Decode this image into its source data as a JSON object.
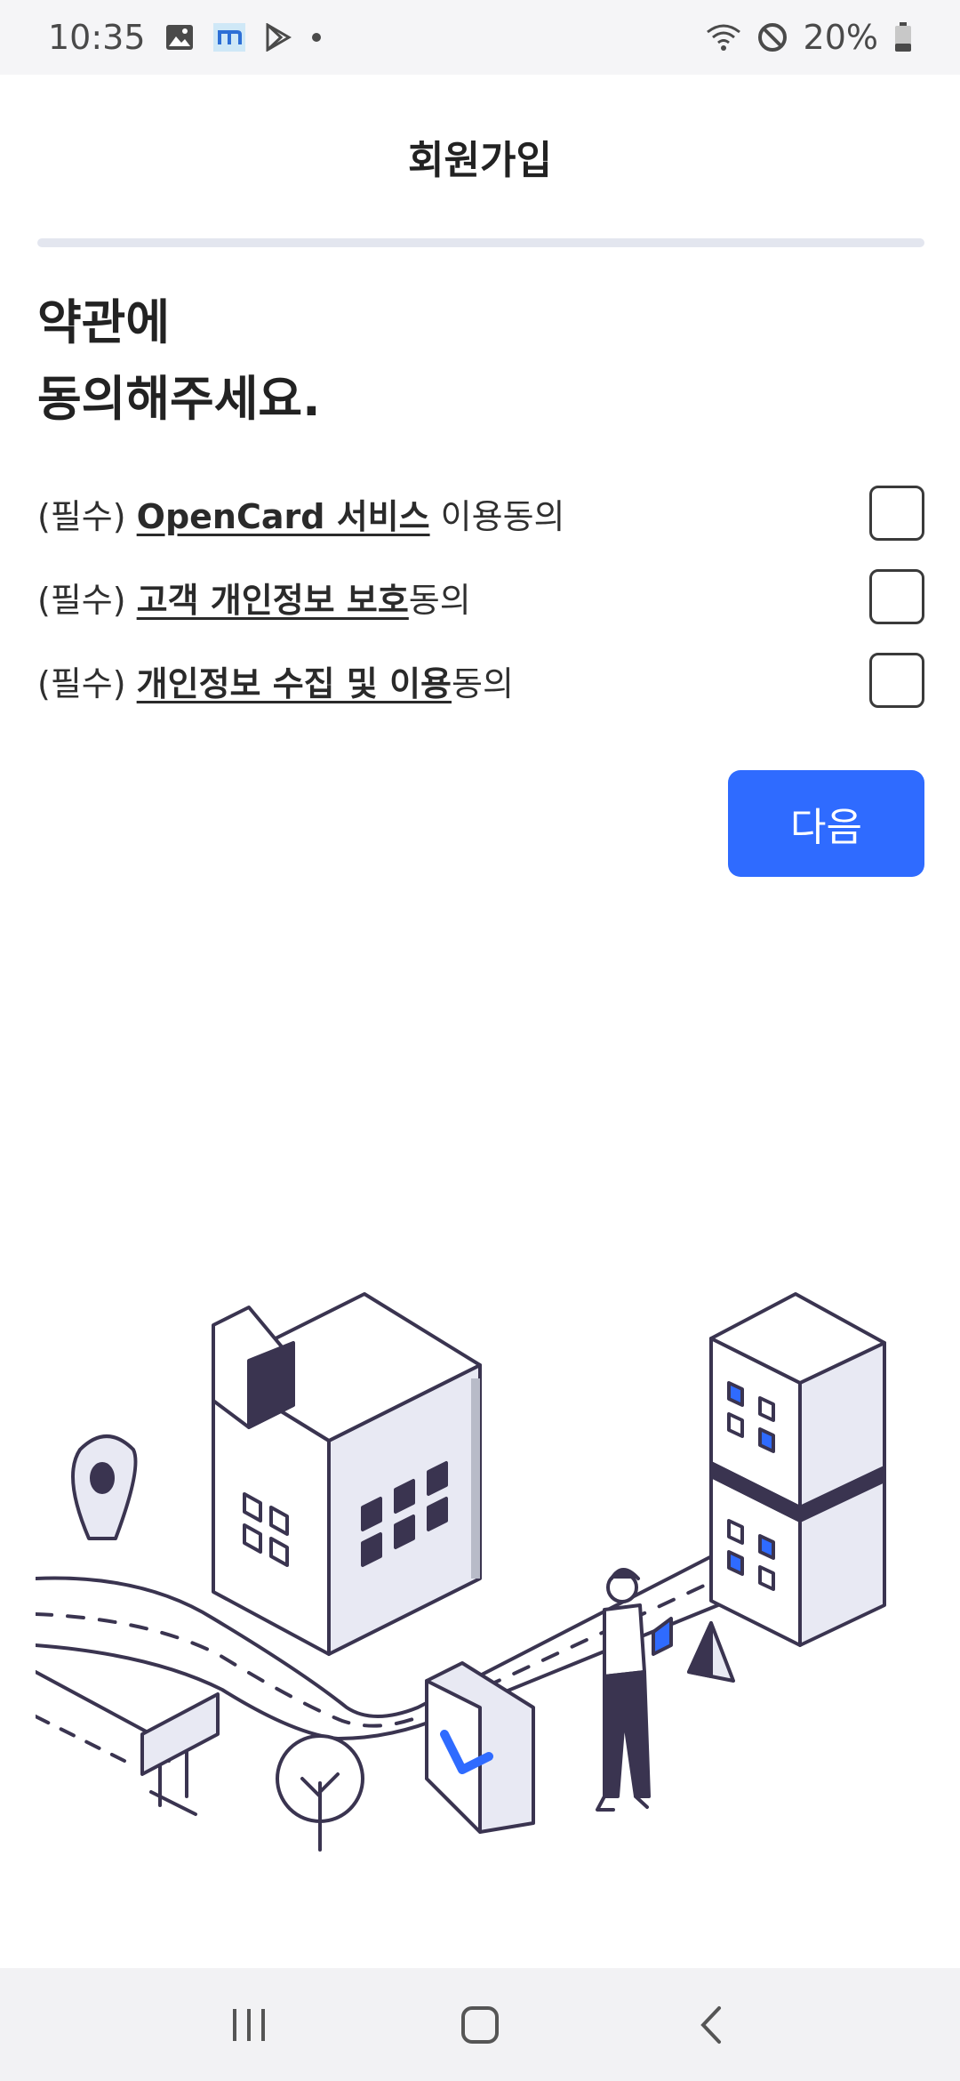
{
  "status_bar": {
    "time": "10:35",
    "battery": "20%",
    "icons": [
      "gallery-icon",
      "app-m-icon",
      "play-store-icon",
      "dot-icon",
      "wifi-icon",
      "do-not-disturb-icon",
      "battery-icon"
    ]
  },
  "header": {
    "title": "회원가입"
  },
  "heading": {
    "line1": "약관에",
    "line2": "동의해주세요."
  },
  "terms": [
    {
      "prefix": "(필수) ",
      "link": "OpenCard 서비스",
      "suffix": " 이용동의",
      "checked": false
    },
    {
      "prefix": "(필수) ",
      "link": "고객 개인정보 보호",
      "suffix": "동의",
      "checked": false
    },
    {
      "prefix": "(필수) ",
      "link": "개인정보 수집 및 이용",
      "suffix": "동의",
      "checked": false
    }
  ],
  "next_button": {
    "label": "다음"
  },
  "colors": {
    "accent": "#2f6bff",
    "progress_track": "#e3e6ef",
    "illustration_stroke": "#3a3450",
    "illustration_fill": "#e8e9f3"
  },
  "nav_bar": {
    "icons": [
      "recent-apps-icon",
      "home-icon",
      "back-icon"
    ]
  }
}
